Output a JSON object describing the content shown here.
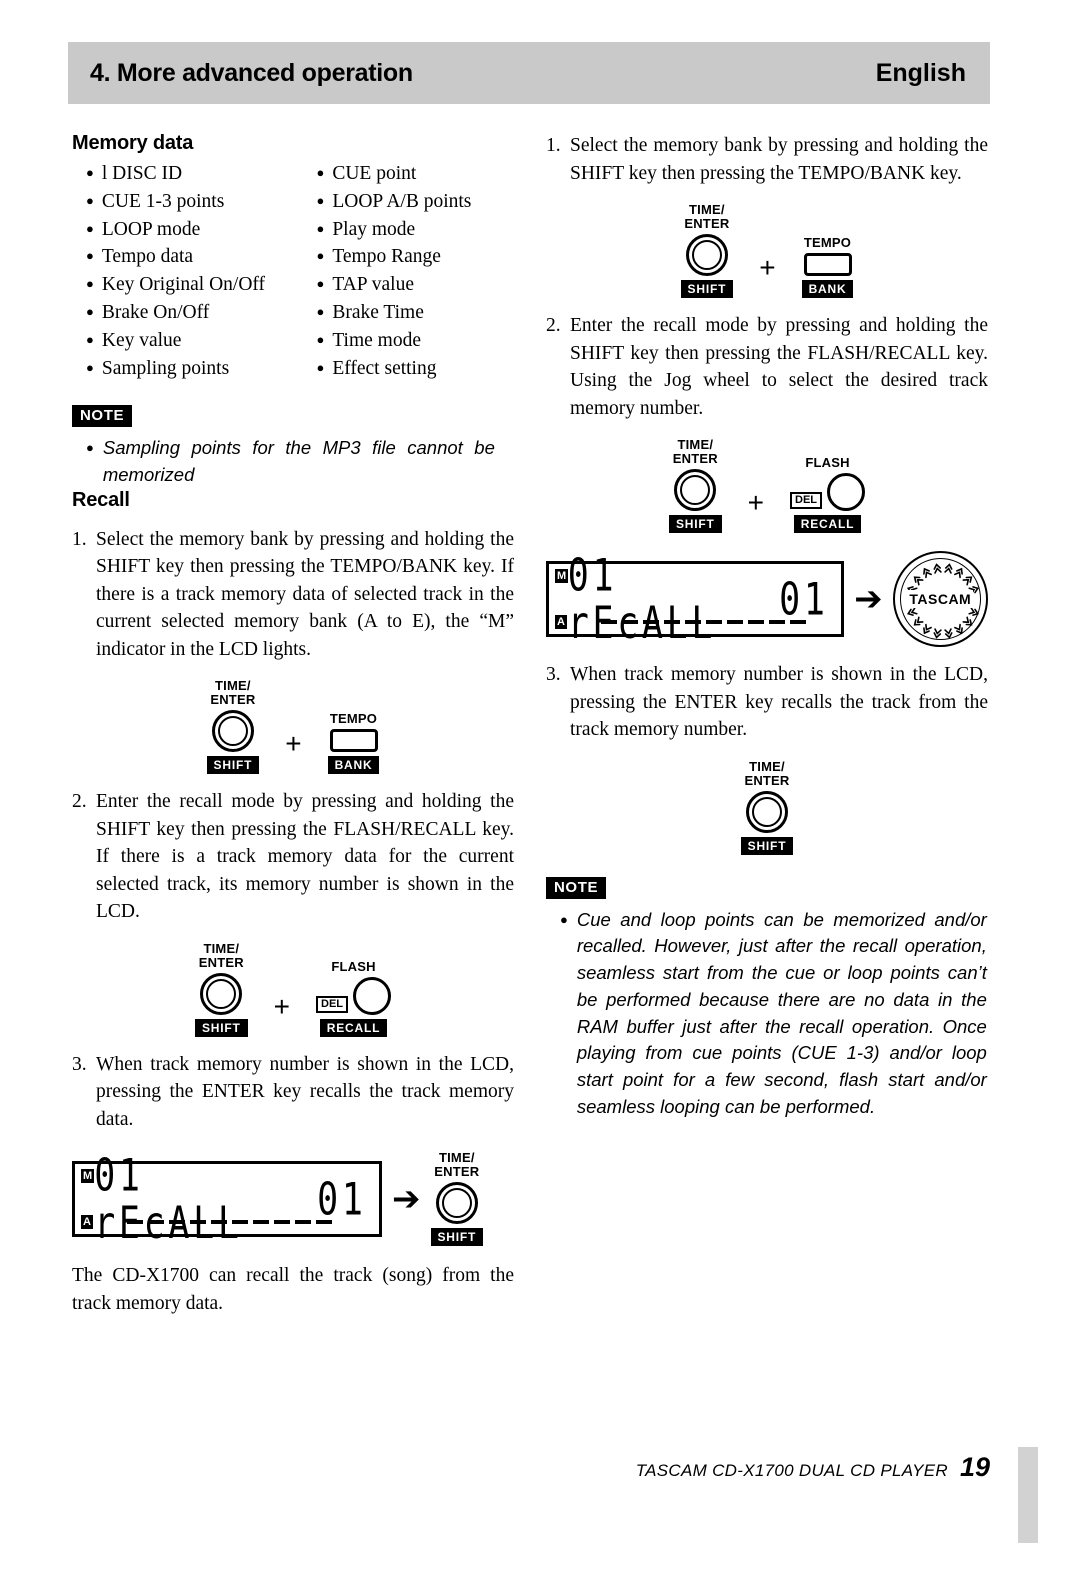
{
  "header": {
    "title": "4. More advanced operation",
    "language": "English"
  },
  "left_column": {
    "memory_data": {
      "heading": "Memory data",
      "items_col1": [
        "l DISC ID",
        "CUE 1-3 points",
        "LOOP mode",
        "Tempo data",
        "Key Original On/Off",
        "Brake On/Off",
        "Key value",
        "Sampling points"
      ],
      "items_col2": [
        "CUE point",
        "LOOP A/B points",
        "Play mode",
        "Tempo Range",
        "TAP value",
        "Brake Time",
        "Time mode",
        "Effect setting"
      ]
    },
    "note": {
      "tag": "NOTE",
      "text": "Sampling points for the MP3 file cannot be memorized"
    },
    "recall": {
      "heading": "Recall",
      "steps": [
        {
          "num": "1.",
          "text": "Select the memory bank by pressing and holding the SHIFT key then pressing the TEMPO/BANK key.  If there is a track memory data of selected track in the current selected memory bank (A to E), the “M” indicator in the LCD lights."
        },
        {
          "num": "2.",
          "text": "Enter the recall mode by pressing and holding the SHIFT key then pressing the FLASH/RECALL key.  If there is a track memory data for the current selected track, its memory number is shown in the LCD."
        },
        {
          "num": "3.",
          "text": "When track memory number is shown in the LCD, pressing the ENTER key recalls the track memory data."
        }
      ]
    },
    "diagram_1": {
      "knob_caption": "TIME/\nENTER",
      "knob_tag": "SHIFT",
      "plus": "+",
      "button_caption": "TEMPO",
      "button_tag": "BANK"
    },
    "diagram_2": {
      "knob_caption": "TIME/\nENTER",
      "knob_tag": "SHIFT",
      "plus": "+",
      "button_caption": "FLASH",
      "button_tag": "RECALL",
      "del_tag": "DEL"
    },
    "lcd": {
      "indicator_m": "M",
      "indicator_a": "A",
      "text_left": "01 rEcALL",
      "text_right": "01",
      "dash_count": 10
    },
    "lcd_target": {
      "knob_caption": "TIME/\nENTER",
      "knob_tag": "SHIFT"
    },
    "tail_paragraph": "The CD-X1700 can recall the track (song) from the track memory data."
  },
  "right_column": {
    "steps": [
      {
        "num": "1.",
        "text": "Select the memory bank by pressing and holding the SHIFT key then pressing the TEMPO/BANK key."
      },
      {
        "num": "2.",
        "text": "Enter the recall mode by pressing and holding the SHIFT key then pressing the FLASH/RECALL key.  Using the Jog wheel to select the desired track memory number."
      },
      {
        "num": "3.",
        "text": "When track memory number is shown in the LCD, pressing the ENTER key recalls the track from the track memory number."
      }
    ],
    "diagram_1": {
      "knob_caption": "TIME/\nENTER",
      "knob_tag": "SHIFT",
      "plus": "+",
      "button_caption": "TEMPO",
      "button_tag": "BANK"
    },
    "diagram_2": {
      "knob_caption": "TIME/\nENTER",
      "knob_tag": "SHIFT",
      "plus": "+",
      "button_caption": "FLASH",
      "button_tag": "RECALL",
      "del_tag": "DEL"
    },
    "lcd": {
      "indicator_m": "M",
      "indicator_a": "A",
      "text_left": "01 rEcALL",
      "text_right": "01",
      "dash_count": 10
    },
    "jog_wheel": {
      "label": "TASCAM"
    },
    "enter_button": {
      "knob_caption": "TIME/\nENTER",
      "knob_tag": "SHIFT"
    },
    "note": {
      "tag": "NOTE",
      "text": "Cue and loop points can be memorized and/or recalled.  However, just after the recall operation, seamless start from the cue or loop points can’t be performed because there are no data in the RAM buffer just after the recall operation.  Once playing from cue points (CUE 1-3) and/or loop start point for a few second, flash start and/or seamless looping can be performed."
    }
  },
  "footer": {
    "text": "TASCAM  CD-X1700  DUAL CD PLAYER",
    "page": "19"
  }
}
